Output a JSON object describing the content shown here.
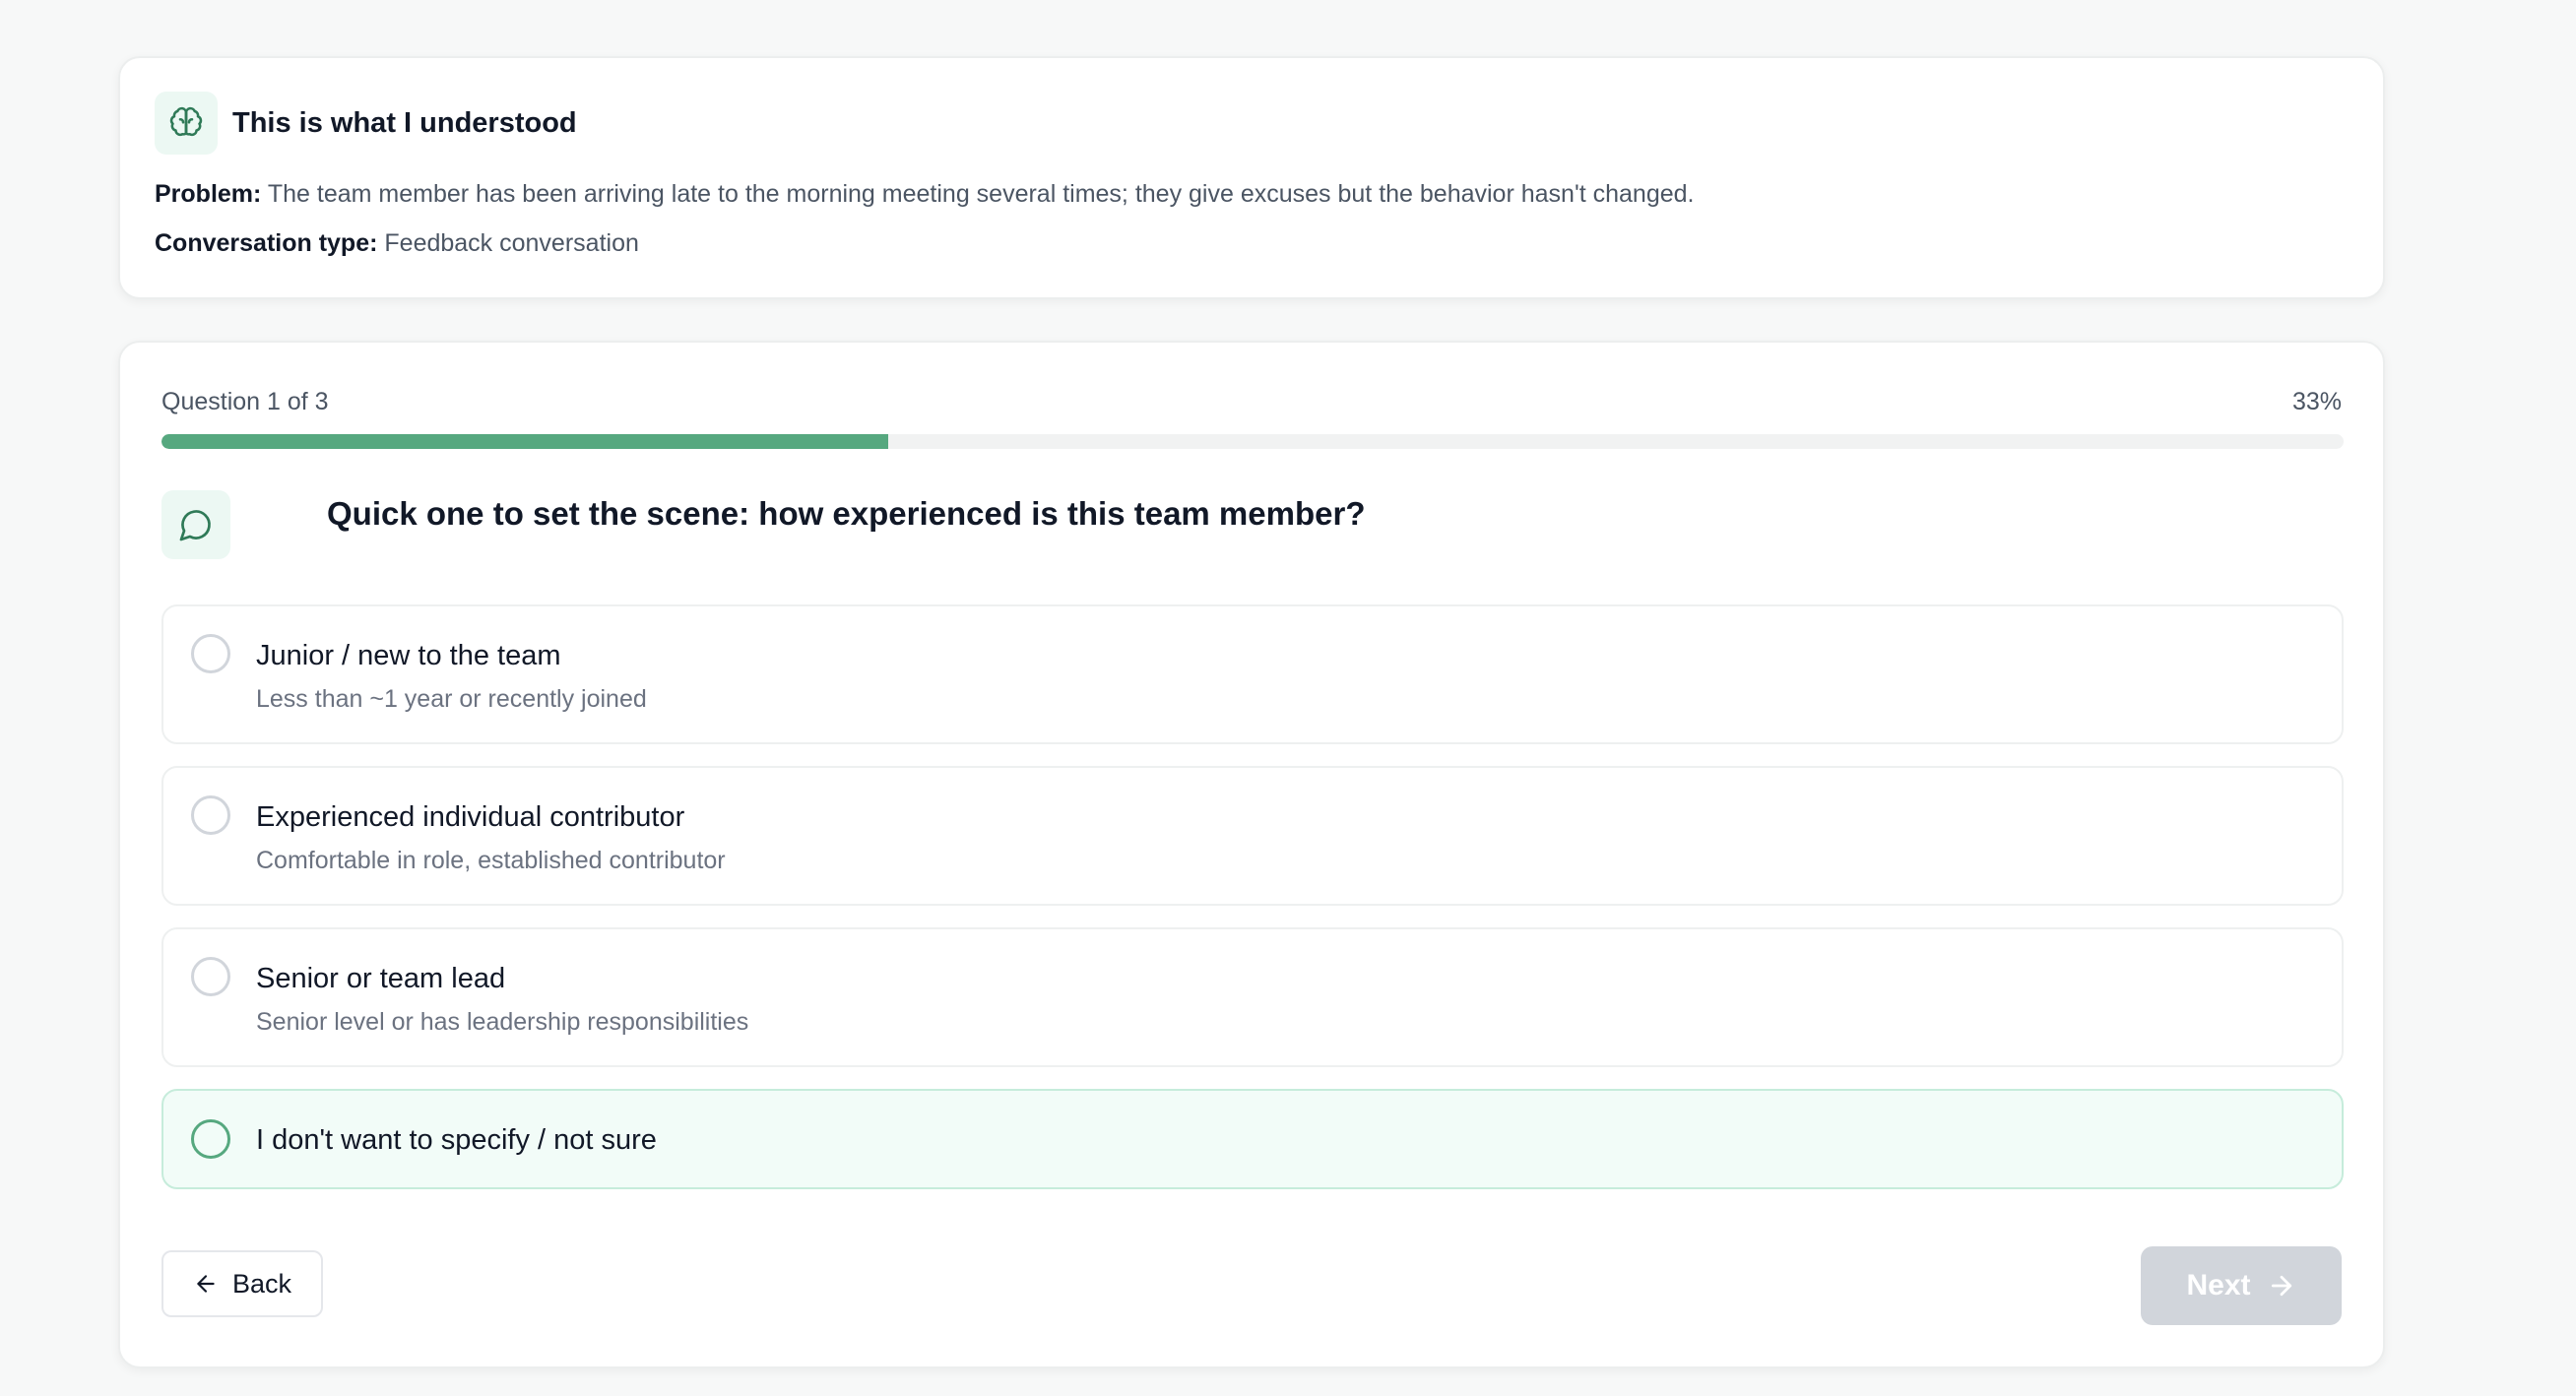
{
  "summary": {
    "title": "This is what I understood",
    "problem_label": "Problem:",
    "problem_text": "The team member has been arriving late to the morning meeting several times; they give excuses but the behavior hasn't changed.",
    "type_label": "Conversation type:",
    "type_text": "Feedback conversation",
    "icon": "brain-icon"
  },
  "question": {
    "counter": "Question 1 of 3",
    "percent_label": "33%",
    "progress_fraction": 0.333,
    "title": "Quick one to set the scene: how experienced is this team member?",
    "icon": "chat-bubble-icon",
    "options": [
      {
        "label": "Junior / new to the team",
        "description": "Less than ~1 year or recently joined"
      },
      {
        "label": "Experienced individual contributor",
        "description": "Comfortable in role, established contributor"
      },
      {
        "label": "Senior or team lead",
        "description": "Senior level or has leadership responsibilities"
      },
      {
        "label": "I don't want to specify / not sure",
        "description": ""
      }
    ]
  },
  "nav": {
    "back_label": "Back",
    "next_label": "Next",
    "back_icon": "arrow-left-icon",
    "next_icon": "arrow-right-icon"
  },
  "colors": {
    "accent": "#56a87f",
    "icon_bg": "#ecf8f3",
    "disabled_button": "#d1d5db"
  }
}
